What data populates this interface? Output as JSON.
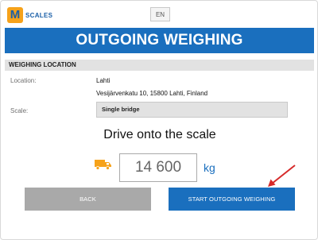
{
  "brand": {
    "mark": "M",
    "name": "SCALES"
  },
  "language": {
    "current": "EN"
  },
  "page": {
    "title": "OUTGOING WEIGHING"
  },
  "location_section": {
    "header": "WEIGHING LOCATION",
    "location_label": "Location:",
    "location_name": "Lahti",
    "location_address": "Vesijärvenkatu 10, 15800 Lahti, Finland",
    "scale_label": "Scale:",
    "scale_value": "Single bridge"
  },
  "instruction": "Drive onto the scale",
  "weight": {
    "value": "14 600",
    "unit": "kg",
    "icon": "truck-icon"
  },
  "actions": {
    "back": "BACK",
    "start": "START OUTGOING WEIGHING"
  },
  "colors": {
    "primary": "#1a6fbe",
    "accent": "#f6a21a",
    "annotation": "#d62a2a",
    "disabled": "#a9a9a9"
  }
}
